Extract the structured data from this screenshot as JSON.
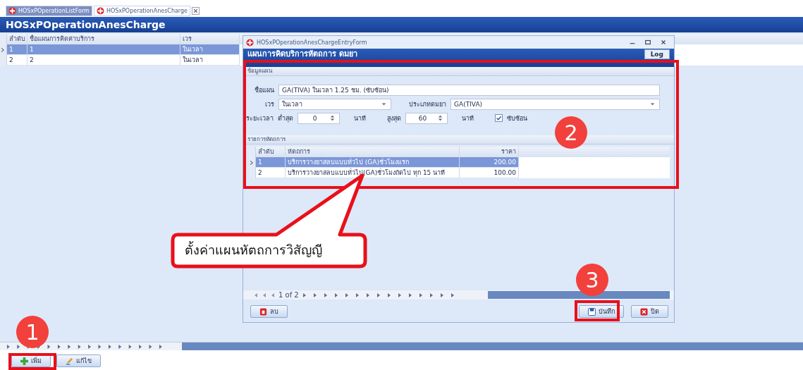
{
  "tabs": [
    {
      "label": "HOSxPOperationListForm",
      "selected": false,
      "closable": false
    },
    {
      "label": "HOSxPOperationAnesCharge",
      "selected": true,
      "closable": true
    }
  ],
  "main": {
    "title": "HOSxPOperationAnesCharge",
    "grid": {
      "columns": [
        "ลำดับ",
        "ชื่อแผนการคิดค่าบริการ",
        "เวร"
      ],
      "rows": [
        {
          "cells": [
            "1",
            "1",
            "ในเวลา"
          ],
          "selected": true
        },
        {
          "cells": [
            "2",
            "2",
            "ในเวลา"
          ],
          "selected": false
        }
      ]
    },
    "buttons": [
      {
        "label": "เพิ่ม",
        "kind": "plus"
      },
      {
        "label": "แก้ไข",
        "kind": "pencil"
      }
    ]
  },
  "dialog": {
    "title": "HOSxPOperationAnesChargeEntryForm",
    "heading": "แผนการคิดบริการหัตถการ ดมยา",
    "log_button": "Log",
    "plan_section": "ข้อมูลแผน",
    "plan_name": {
      "label": "ชื่อแผน",
      "value": "GA(TIVA) ในเวลา 1.25 ชม. (ซับซ้อน)"
    },
    "shift": {
      "label": "เวร",
      "value": "ในเวลา"
    },
    "anes_type": {
      "label": "ประเภทดมยา",
      "value": "GA(TIVA)"
    },
    "duration": {
      "label": "ระยะเวลา",
      "min_label": "ต่ำสุด",
      "min_value": "0",
      "min_unit": "นาที",
      "max_label": "สูงสุด",
      "max_value": "60",
      "max_unit": "นาที"
    },
    "complex": {
      "label": "ซับซ้อน",
      "checked": true
    },
    "items_section": "รายการหัตถการ",
    "grid": {
      "columns": [
        "ลำดับ",
        "หัตถการ",
        "ราคา"
      ],
      "rows": [
        {
          "cells": [
            "1",
            "บริการวางยาสลบแบบทั่วไป (GA)ชั่วโมงแรก",
            "200.00"
          ],
          "selected": true
        },
        {
          "cells": [
            "2",
            "บริการวางยาสลบแบบทั่วไป(GA)ชั่วโมงถัดไป ทุก 15 นาที",
            "100.00"
          ],
          "selected": false
        }
      ]
    },
    "navigator": "1 of 2",
    "buttons": [
      {
        "label": "ลบ",
        "kind": "delete"
      },
      {
        "label": "บันทึก",
        "kind": "save"
      },
      {
        "label": "ปิด",
        "kind": "close"
      }
    ]
  },
  "annotations": {
    "markers": [
      "1",
      "2",
      "3"
    ],
    "callout": "ตั้งค่าแผนหัตถการวิสัญญี"
  }
}
